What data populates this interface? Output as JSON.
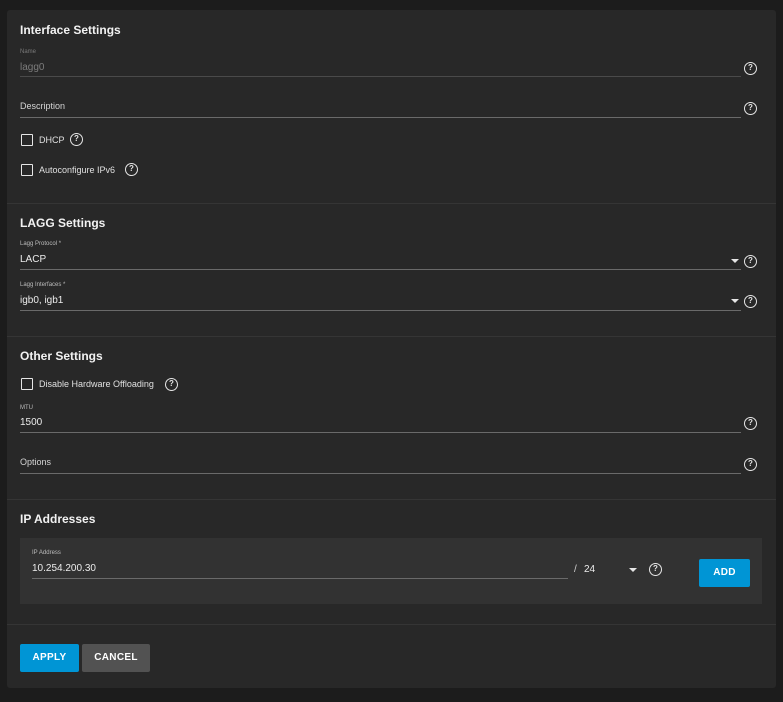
{
  "interface_settings": {
    "title": "Interface Settings",
    "name": {
      "label": "Name",
      "value": "lagg0"
    },
    "description": {
      "placeholder": "Description",
      "value": ""
    },
    "dhcp": {
      "label": "DHCP",
      "checked": false
    },
    "autoconfigure_ipv6": {
      "label": "Autoconfigure IPv6",
      "checked": false
    }
  },
  "lagg_settings": {
    "title": "LAGG Settings",
    "lagg_protocol": {
      "label": "Lagg Protocol *",
      "value": "LACP"
    },
    "lagg_interfaces": {
      "label": "Lagg Interfaces *",
      "value": "igb0, igb1"
    }
  },
  "other_settings": {
    "title": "Other Settings",
    "disable_hw_offloading": {
      "label": "Disable Hardware Offloading",
      "checked": false
    },
    "mtu": {
      "label": "MTU",
      "value": "1500"
    },
    "options": {
      "placeholder": "Options",
      "value": ""
    }
  },
  "ip_addresses": {
    "title": "IP Addresses",
    "ip_label": "IP Address",
    "ip_value": "10.254.200.30",
    "separator": "/",
    "netmask": "24",
    "add_label": "ADD"
  },
  "actions": {
    "apply_label": "APPLY",
    "cancel_label": "CANCEL"
  },
  "icons": {
    "help": "help-circle-icon",
    "dropdown": "caret-down-icon",
    "help_glyph": "?"
  },
  "colors": {
    "accent": "#0095d5",
    "background": "#282828",
    "page": "#1c1c1c",
    "secondary_button": "#525252"
  }
}
